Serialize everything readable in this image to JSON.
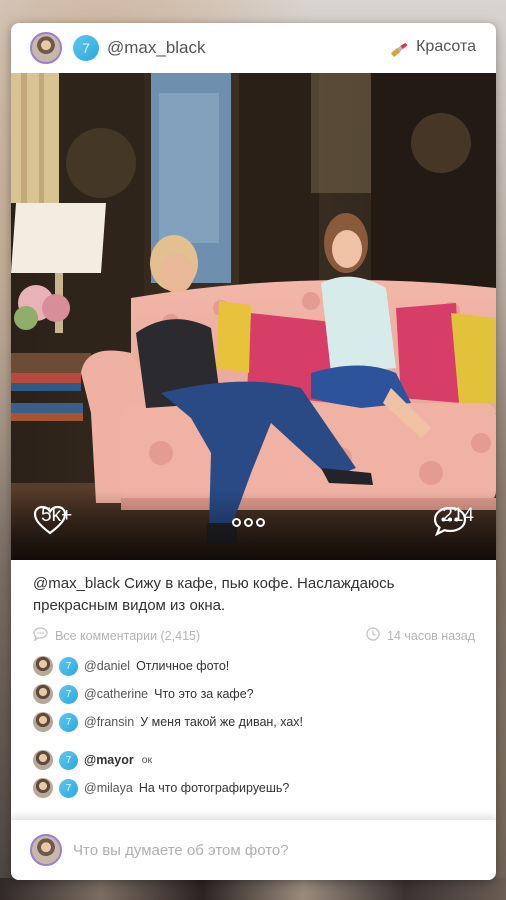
{
  "header": {
    "level": "7",
    "username": "@max_black",
    "category": "Красота"
  },
  "photo_bar": {
    "likes": "5k+",
    "comments": "214"
  },
  "caption": {
    "author": "@max_black",
    "text": "Сижу в кафе, пью кофе. Наслаждаюсь прекрасным видом из окна."
  },
  "meta": {
    "all_comments": "Все комментарии (2,415)",
    "time": "14 часов назад"
  },
  "comments": [
    {
      "level": "7",
      "user": "@daniel",
      "text": "Отличное фото!"
    },
    {
      "level": "7",
      "user": "@catherine",
      "text": "Что это за кафе?"
    },
    {
      "level": "7",
      "user": "@fransin",
      "text": "У меня такой же диван, хах!"
    },
    {
      "level": "7",
      "user": "@mayor",
      "text": "ок"
    },
    {
      "level": "7",
      "user": "@milaya",
      "text": "На что фотографируешь?"
    }
  ],
  "input": {
    "placeholder": "Что вы думаете об этом фото?"
  },
  "colors": {
    "level_badge": "#2aa8dc",
    "avatar_ring": "#9b7fd0"
  }
}
